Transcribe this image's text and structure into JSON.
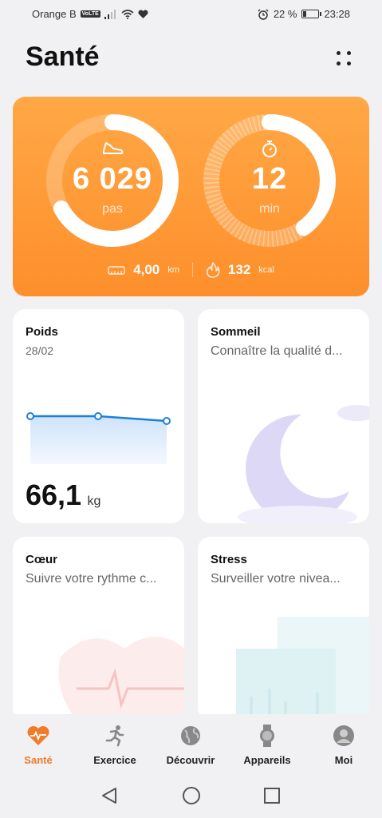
{
  "status": {
    "carrier": "Orange B",
    "volte": "VoLTE",
    "battery": "22 %",
    "time": "23:28"
  },
  "header": {
    "title": "Santé"
  },
  "activity": {
    "steps": "6 029",
    "steps_unit": "pas",
    "steps_progress": 0.67,
    "minutes": "12",
    "minutes_unit": "min",
    "minutes_progress": 0.4,
    "distance": "4,00",
    "distance_unit": "km",
    "calories": "132",
    "calories_unit": "kcal"
  },
  "tiles": {
    "weight": {
      "title": "Poids",
      "date": "28/02",
      "value": "66,1",
      "unit": "kg"
    },
    "sleep": {
      "title": "Sommeil",
      "subtitle": "Connaître la qualité d..."
    },
    "heart": {
      "title": "Cœur",
      "subtitle": "Suivre votre rythme c..."
    },
    "stress": {
      "title": "Stress",
      "subtitle": "Surveiller votre nivea..."
    }
  },
  "nav": [
    {
      "label": "Santé",
      "icon": "heart-icon"
    },
    {
      "label": "Exercice",
      "icon": "runner-icon"
    },
    {
      "label": "Découvrir",
      "icon": "globe-icon"
    },
    {
      "label": "Appareils",
      "icon": "watch-icon"
    },
    {
      "label": "Moi",
      "icon": "person-icon"
    }
  ],
  "colors": {
    "accent": "#f07b2a",
    "card": "#fd9a38",
    "chart_line": "#1e7fd6"
  }
}
